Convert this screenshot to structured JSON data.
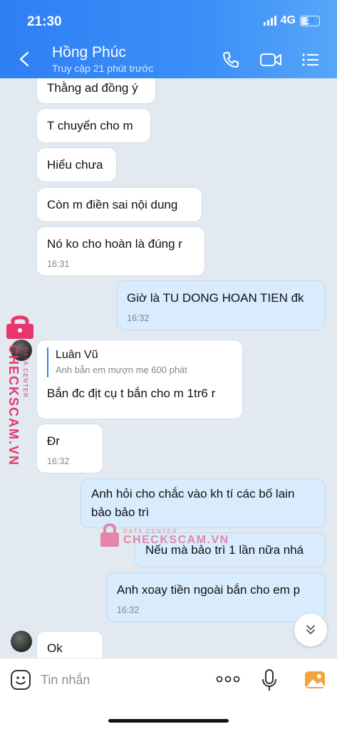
{
  "status_bar": {
    "time": "21:30",
    "network": "4G",
    "battery": "38"
  },
  "header": {
    "title": "Hồng Phúc",
    "subtitle": "Truy cập 21 phút trước"
  },
  "messages": [
    {
      "text": "Thằng ad đồng ý",
      "side": "in"
    },
    {
      "text": "T chuyển cho m",
      "side": "in"
    },
    {
      "text": "Hiểu chưa",
      "side": "in"
    },
    {
      "text": "Còn m điền sai nội dung",
      "side": "in"
    },
    {
      "text": "Nó ko cho hoàn là đúng r",
      "time": "16:31",
      "side": "in"
    },
    {
      "text": "Giờ là TU DONG HOAN TIEN đk",
      "time": "16:32",
      "side": "out"
    },
    {
      "reply_name": "Luân Vũ",
      "reply_text": "Anh bắn em mượn mẹ 600 phát",
      "text": "Bắn đc địt cụ t bắn cho m 1tr6 r",
      "side": "in"
    },
    {
      "text": "Đr",
      "time": "16:32",
      "side": "in"
    },
    {
      "text_line1": "Anh hỏi cho chắc vào kh tí các bố lain",
      "text_line2": "bảo bảo trì",
      "side": "out"
    },
    {
      "text": "Nếu mà bảo trì 1 lần nữa nhá",
      "side": "out"
    },
    {
      "text": "Anh xoay tiền ngoài bắn cho em p",
      "time": "16:32",
      "side": "out"
    },
    {
      "text": "Ok",
      "side": "in"
    }
  ],
  "input": {
    "placeholder": "Tin nhắn"
  },
  "watermark": {
    "brand": "CHECKSCAM.VN",
    "sub": "DATA CENTER"
  },
  "colors": {
    "header": "#3b8ff7",
    "outgoing": "#d8ecfd",
    "incoming": "#ffffff",
    "watermark": "#e8356c"
  }
}
